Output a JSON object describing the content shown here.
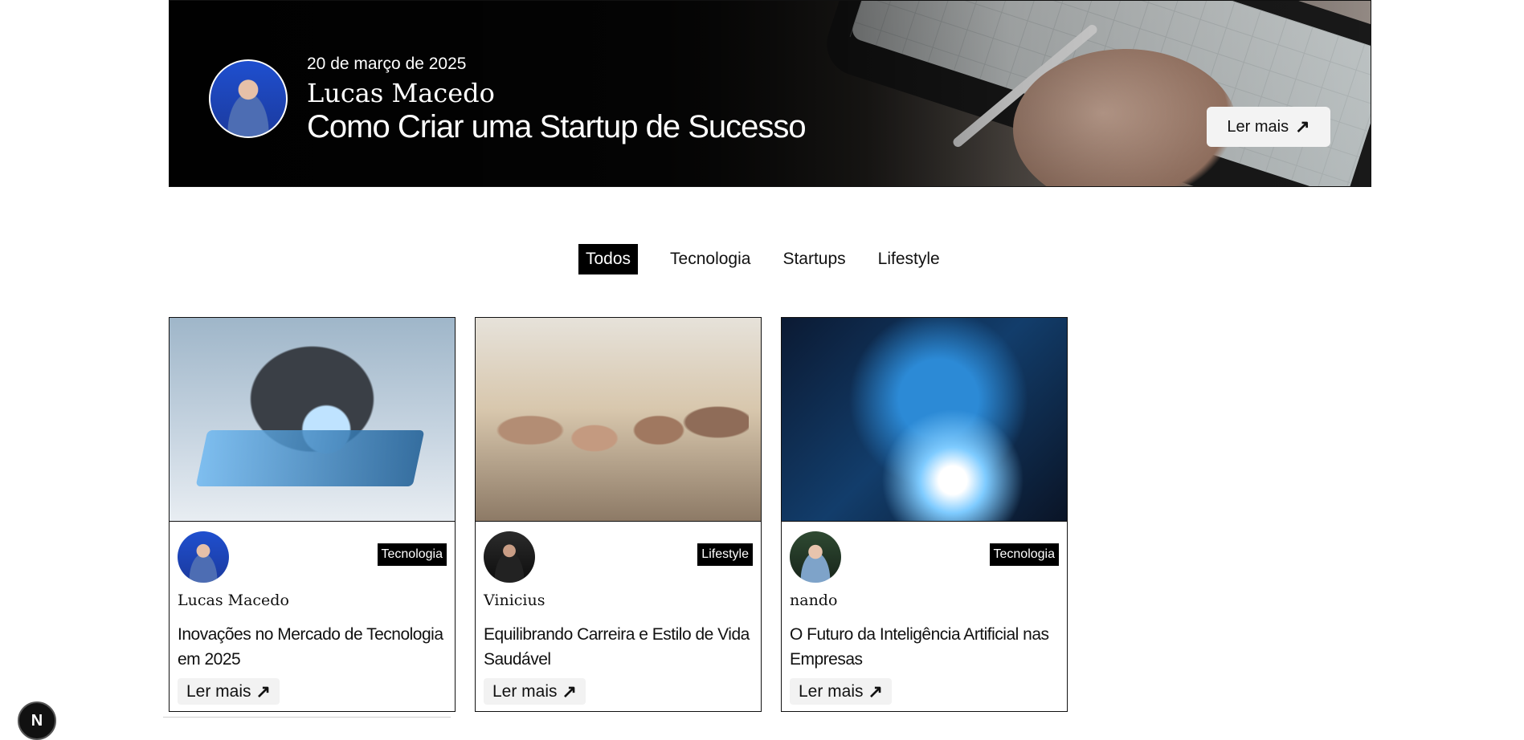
{
  "hero": {
    "date": "20 de março de 2025",
    "author": "Lucas Macedo",
    "title": "Como Criar uma Startup de Sucesso",
    "button_label": "Ler mais",
    "arrow": "↗"
  },
  "tabs": [
    {
      "label": "Todos",
      "active": true
    },
    {
      "label": "Tecnologia",
      "active": false
    },
    {
      "label": "Startups",
      "active": false
    },
    {
      "label": "Lifestyle",
      "active": false
    }
  ],
  "cards": [
    {
      "category": "Tecnologia",
      "author": "Lucas Macedo",
      "title": "Inovações no Mercado de Tecnologia em 2025",
      "button_label": "Ler mais",
      "arrow": "↗"
    },
    {
      "category": "Lifestyle",
      "author": "Vinicius",
      "title": "Equilibrando Carreira e Estilo de Vida Saudável",
      "button_label": "Ler mais",
      "arrow": "↗"
    },
    {
      "category": "Tecnologia",
      "author": "nando",
      "title": "O Futuro da Inteligência Artificial nas Empresas",
      "button_label": "Ler mais",
      "arrow": "↗"
    }
  ],
  "dev_badge": {
    "label": "N"
  }
}
